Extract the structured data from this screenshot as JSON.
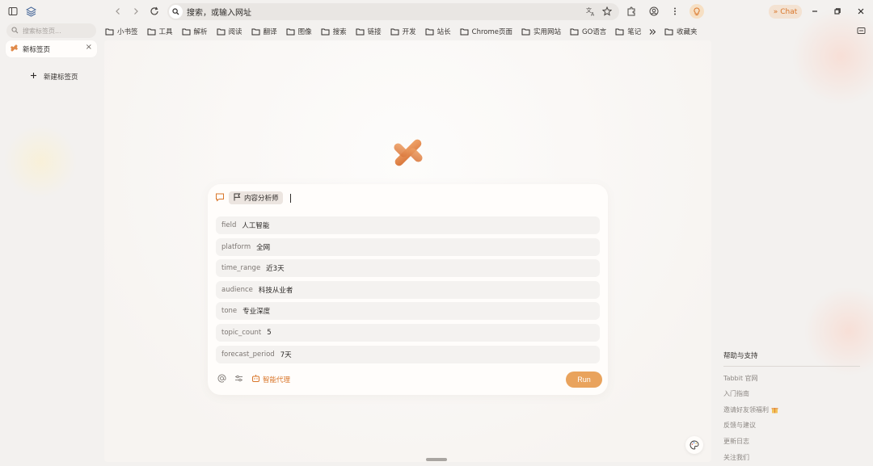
{
  "address_bar": {
    "placeholder": "搜索，或输入网址"
  },
  "chat_button": {
    "label": "Chat"
  },
  "bookmarks": [
    "小书签",
    "工具",
    "解析",
    "阅读",
    "翻译",
    "图像",
    "搜索",
    "链接",
    "开发",
    "站长",
    "Chrome页面",
    "实用网站",
    "GO语言",
    "笔记"
  ],
  "bookmarks_favorites": "收藏夹",
  "sidebar": {
    "search_placeholder": "搜索标签页...",
    "active_tab": "新标签页",
    "new_tab_label": "新建标签页"
  },
  "prompt_card": {
    "role_tag": "内容分析师",
    "fields": [
      {
        "key": "field",
        "value": "人工智能"
      },
      {
        "key": "platform",
        "value": "全网"
      },
      {
        "key": "time_range",
        "value": "近3天"
      },
      {
        "key": "audience",
        "value": "科技从业者"
      },
      {
        "key": "tone",
        "value": "专业深度"
      },
      {
        "key": "topic_count",
        "value": "5"
      },
      {
        "key": "forecast_period",
        "value": "7天"
      }
    ],
    "agent_label": "智能代理",
    "run_label": "Run"
  },
  "help": {
    "title": "帮助与支持",
    "items": [
      "Tabbit 官网",
      "入门指南",
      "邀请好友领福利",
      "反馈与建议",
      "更新日志",
      "关注我们"
    ]
  },
  "colors": {
    "accent": "#d9762a",
    "run_button": "#e9a35d",
    "logo": "#e08a4a"
  }
}
